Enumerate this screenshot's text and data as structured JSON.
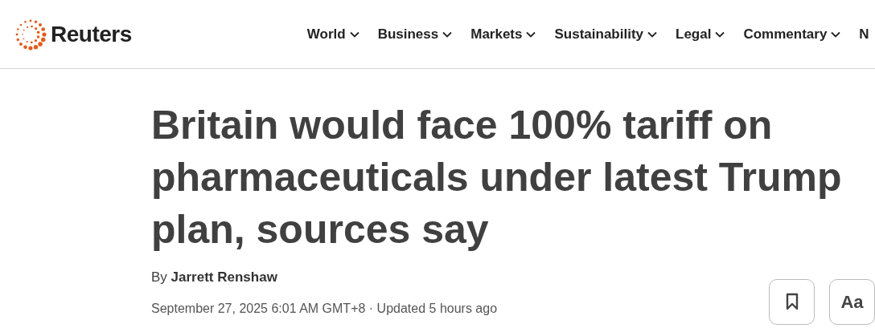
{
  "header": {
    "logo": "Reuters",
    "nav": [
      {
        "label": "World",
        "has_menu": true
      },
      {
        "label": "Business",
        "has_menu": true
      },
      {
        "label": "Markets",
        "has_menu": true
      },
      {
        "label": "Sustainability",
        "has_menu": true
      },
      {
        "label": "Legal",
        "has_menu": true
      },
      {
        "label": "Commentary",
        "has_menu": true
      },
      {
        "label": "N",
        "has_menu": false
      }
    ]
  },
  "article": {
    "headline": "Britain would face 100% tariff on pharmaceuticals under latest Trump plan, sources say",
    "byline_prefix": "By",
    "author": "Jarrett Renshaw",
    "dateline": "September 27, 2025 6:01 AM GMT+8 · Updated 5 hours ago",
    "text_size_button": "Aa"
  }
}
